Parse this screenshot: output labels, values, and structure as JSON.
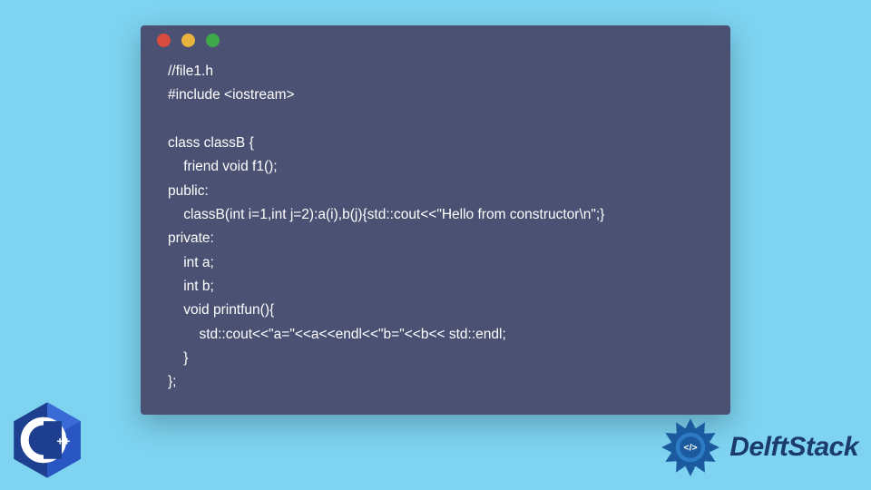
{
  "window": {
    "dots": [
      "red",
      "yellow",
      "green"
    ]
  },
  "code": {
    "lines": [
      "//file1.h",
      "#include <iostream>",
      "",
      "class classB {",
      "    friend void f1();",
      "public:",
      "    classB(int i=1,int j=2):a(i),b(j){std::cout<<\"Hello from constructor\\n\";}",
      "private:",
      "    int a;",
      "    int b;",
      "    void printfun(){",
      "        std::cout<<\"a=\"<<a<<endl<<\"b=\"<<b<< std::endl;",
      "    }",
      "};"
    ]
  },
  "branding": {
    "cpp_label": "C++",
    "site_name": "DelftStack"
  },
  "colors": {
    "page_bg": "#7dd3f0",
    "window_bg": "#4a5172",
    "code_text": "#ffffff",
    "dot_red": "#d94a3f",
    "dot_yellow": "#e8b33d",
    "dot_green": "#3fa84a",
    "brand_blue": "#1b3a6e",
    "cpp_blue": "#1e3f8f"
  }
}
